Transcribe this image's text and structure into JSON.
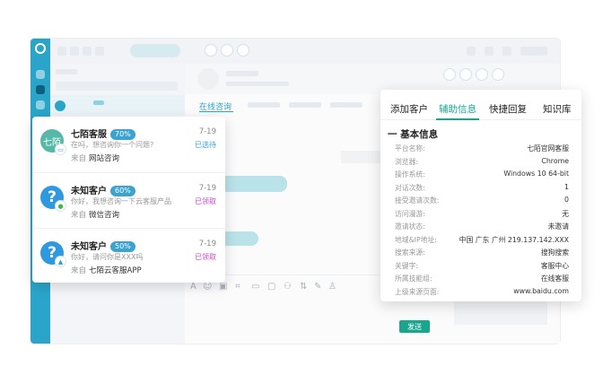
{
  "chat_tab": "在线咨询",
  "tool_glyphs": [
    "A",
    "☺",
    "▣",
    "⌗",
    "▭",
    "▢",
    "⚇",
    "⇅",
    "✎",
    "♙"
  ],
  "notifications": [
    {
      "avatar": "七陌",
      "avatar_color": "#56b9a7",
      "name": "七陌客服",
      "badge": "70%",
      "date": "7-19",
      "message": "在吗，想咨询你一个问题?",
      "status": "已选待",
      "status_color": "#3aa3cf",
      "source_prefix": "来自",
      "source": "网站咨询",
      "sub_icon": "chat-icon"
    },
    {
      "avatar": "?",
      "avatar_color": "#2f99e0",
      "name": "未知客户",
      "badge": "60%",
      "date": "7-19",
      "message": "你好，我想咨询一下云客服产品",
      "status": "已领取",
      "status_color": "#c24fc8",
      "source_prefix": "来自",
      "source": "微信咨询",
      "sub_icon": "wechat-icon"
    },
    {
      "avatar": "?",
      "avatar_color": "#2f99e0",
      "name": "未知客户",
      "badge": "50%",
      "date": "7-19",
      "message": "你好，请问你是XXX吗",
      "status": "已领取",
      "status_color": "#c24fc8",
      "source_prefix": "来自",
      "source": "七陌云客服APP",
      "sub_icon": "app-icon"
    }
  ],
  "panel": {
    "tabs": [
      "添加客户",
      "辅助信息",
      "快捷回复",
      "知识库"
    ],
    "active_tab": 1,
    "section_title": "一 基本信息",
    "rows": [
      {
        "label": "平台名称:",
        "value": "七陌官网客服"
      },
      {
        "label": "浏览器:",
        "value": "Chrome"
      },
      {
        "label": "操作系统:",
        "value": "Windows 10 64-bit"
      },
      {
        "label": "对话次数:",
        "value": "1"
      },
      {
        "label": "接受邀请次数:",
        "value": "0"
      },
      {
        "label": "访问漫游:",
        "value": "无"
      },
      {
        "label": "邀请状态:",
        "value": "未邀请"
      },
      {
        "label": "地域&IP地址:",
        "value": "中国 广东 广州 219.137.142.XXX"
      },
      {
        "label": "搜索来源:",
        "value": "搜狗搜索"
      },
      {
        "label": "关键字:",
        "value": "客服中心"
      },
      {
        "label": "所属技能组:",
        "value": "在线客服"
      },
      {
        "label": "上级来源页面:",
        "value": "www.baidu.com"
      }
    ]
  },
  "send_label": "发送",
  "colors": {
    "accent": "#1aa68e",
    "rail": "#2aa5c9",
    "badge": "#3aa3cf"
  }
}
